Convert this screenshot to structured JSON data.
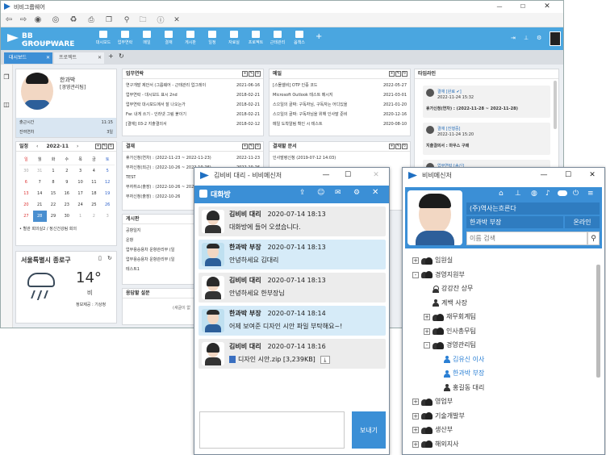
{
  "main": {
    "title": "비비그룹웨어",
    "brand": "BB GROUPWARE",
    "brand_sub": "NEW GENERAL GROUPWARE TOOL",
    "nav": [
      "대시보드",
      "업무연락",
      "메일",
      "결재",
      "게시판",
      "일정",
      "자료실",
      "프로젝트",
      "근태관리",
      "옵책스"
    ],
    "tabs": [
      {
        "label": "대시보드"
      },
      {
        "label": "프로젝트"
      }
    ],
    "profile": {
      "name": "한과박",
      "dept": "[경영관리팀]",
      "rows": [
        {
          "label": "출근시간",
          "value": "11:15"
        },
        {
          "label": "잔여연차",
          "value": "3일"
        }
      ]
    },
    "calendar": {
      "title": "일정",
      "month": "2022-11",
      "weekdays": [
        "일",
        "월",
        "화",
        "수",
        "목",
        "금",
        "토"
      ],
      "days": [
        [
          "30",
          "31",
          "1",
          "2",
          "3",
          "4",
          "5"
        ],
        [
          "6",
          "7",
          "8",
          "9",
          "10",
          "11",
          "12"
        ],
        [
          "13",
          "14",
          "15",
          "16",
          "17",
          "18",
          "19"
        ],
        [
          "20",
          "21",
          "22",
          "23",
          "24",
          "25",
          "26"
        ],
        [
          "27",
          "28",
          "29",
          "30",
          "1",
          "2",
          "3"
        ]
      ],
      "today": "28",
      "event": "• 별관 회의실2 / 정신건강팀 회의"
    },
    "weather": {
      "city": "서울특별시 종로구",
      "temp": "14°",
      "desc": "비",
      "source": "정보제공 : 기상청"
    },
    "work": {
      "title": "업무연락",
      "rows": [
        [
          "연구개발 제안서 (그룹웨어 - 근태관리 업그레이",
          "2021-06-16"
        ],
        [
          "업무연락 - 대시보드 표시 2nd",
          "2018-02-21"
        ],
        [
          "업무연락 대시보드에서 잘 나오는가",
          "2018-02-21"
        ],
        [
          "Fw: 내게 쓰기 - 인라넷 그림 붙이기",
          "2018-02-21"
        ],
        [
          "[결재] 03-2 지출결의서",
          "2018-02-12"
        ]
      ]
    },
    "mail": {
      "title": "메일",
      "rows": [
        [
          "[스몰셀비] OTP 인증 코드",
          "2022-05-27"
        ],
        [
          "Microsoft Outlook 테스트 메시지",
          "2021-03-01"
        ],
        [
          "스으일의 골짜: 구독자님, 구독자는 어디있을",
          "2021-01-20"
        ],
        [
          "스으일의 골짜: 구독자님을 위해 인사말 준비",
          "2020-12-16"
        ],
        [
          "메일 도착알림 확인 시 테스트",
          "2020-08-10"
        ]
      ]
    },
    "approval": {
      "title": "결재",
      "rows": [
        [
          "휴가신청(연차) : (2022-11-23 ~ 2022-11-23)",
          "2022-11-23"
        ],
        [
          "부자신청(외근) : (2022-10-26 ~ 2022-10-26)",
          "2022-10-26"
        ],
        [
          "TEST",
          "2022-10-26"
        ],
        [
          "부자취소(출장) : (2022-10-26 ~ 2022-10-26)",
          "2022-10-26"
        ],
        [
          "부자신청(출장) : (2022-10-26",
          "2022-10-26"
        ]
      ]
    },
    "approval_doc": {
      "title": "결재할 문서",
      "rows": [
        [
          "인사발령신청 (2019-07-12 14:03)",
          ""
        ]
      ]
    },
    "board": {
      "title": "게시판",
      "rows": [
        [
          "공항일지",
          ""
        ],
        [
          "운항",
          ""
        ],
        [
          "업무용승용차 운항관리부 (일",
          ""
        ],
        [
          "업무용승용차 운항관리부 (일",
          ""
        ],
        [
          "테스트1",
          ""
        ]
      ]
    },
    "survey": {
      "title": "응답할 설문",
      "empty": "(새글이 없"
    },
    "timeline": {
      "title": "타임라인",
      "items": [
        {
          "head": "결재 [완료 ✔]",
          "date": "2022-11-24 15:32",
          "body": "휴가신청(연차) : (2022-11-28 ~ 2022-11-28)"
        },
        {
          "head": "결재 [진행중]",
          "date": "2022-11-24 15:20",
          "body": "지출결의서 : 마우스 구매"
        },
        {
          "head": "업무연락 [송신]",
          "date": "",
          "body": ""
        }
      ]
    }
  },
  "chat": {
    "title": "김비비 대리 - 비비메신저",
    "room": "대화방",
    "messages": [
      {
        "name": "김비비 대리",
        "time": "2020-07-14 18:13",
        "text": "대화방에 들어 오셨습니다.",
        "mine": false
      },
      {
        "name": "한과박 부장",
        "time": "2020-07-14 18:13",
        "text": "안녕하세요 김대리",
        "mine": true
      },
      {
        "name": "김비비 대리",
        "time": "2020-07-14 18:13",
        "text": "안녕하세요 한부장님",
        "mine": false
      },
      {
        "name": "한과박 부장",
        "time": "2020-07-14 18:14",
        "text": "어제 보여준 디자인 시안 파일 부탁해요~!",
        "mine": true
      },
      {
        "name": "김비비 대리",
        "time": "2020-07-14 18:16",
        "text": "디자인 시안.zip [3,239KB]",
        "mine": false
      }
    ],
    "send": "보내기"
  },
  "messenger": {
    "title": "비비메신저",
    "company": "(주)역사는흐른다",
    "user": "한과박 부장",
    "status": "온라인",
    "search_placeholder": "이름 검색",
    "tree": [
      {
        "label": "임원실",
        "kind": "group",
        "pm": "+",
        "indent": 0
      },
      {
        "label": "경영지원부",
        "kind": "group",
        "pm": "-",
        "indent": 0
      },
      {
        "label": "강강잔 상무",
        "kind": "person-ring",
        "pm": "",
        "indent": 1
      },
      {
        "label": "계백 사장",
        "kind": "person",
        "pm": "",
        "indent": 1
      },
      {
        "label": "재무회계팀",
        "kind": "group",
        "pm": "+",
        "indent": 1
      },
      {
        "label": "인사총무팀",
        "kind": "group",
        "pm": "+",
        "indent": 1
      },
      {
        "label": "경영관리팀",
        "kind": "group",
        "pm": "-",
        "indent": 1
      },
      {
        "label": "김유신 이사",
        "kind": "person-blue",
        "pm": "",
        "indent": 2
      },
      {
        "label": "한과박 부장",
        "kind": "person-blue",
        "pm": "",
        "indent": 2
      },
      {
        "label": "홍길동 대리",
        "kind": "person",
        "pm": "",
        "indent": 2
      },
      {
        "label": "영업부",
        "kind": "group",
        "pm": "+",
        "indent": 0
      },
      {
        "label": "기술개발부",
        "kind": "group",
        "pm": "+",
        "indent": 0
      },
      {
        "label": "생산부",
        "kind": "group",
        "pm": "+",
        "indent": 0
      },
      {
        "label": "해외지사",
        "kind": "group",
        "pm": "+",
        "indent": 0
      }
    ]
  }
}
